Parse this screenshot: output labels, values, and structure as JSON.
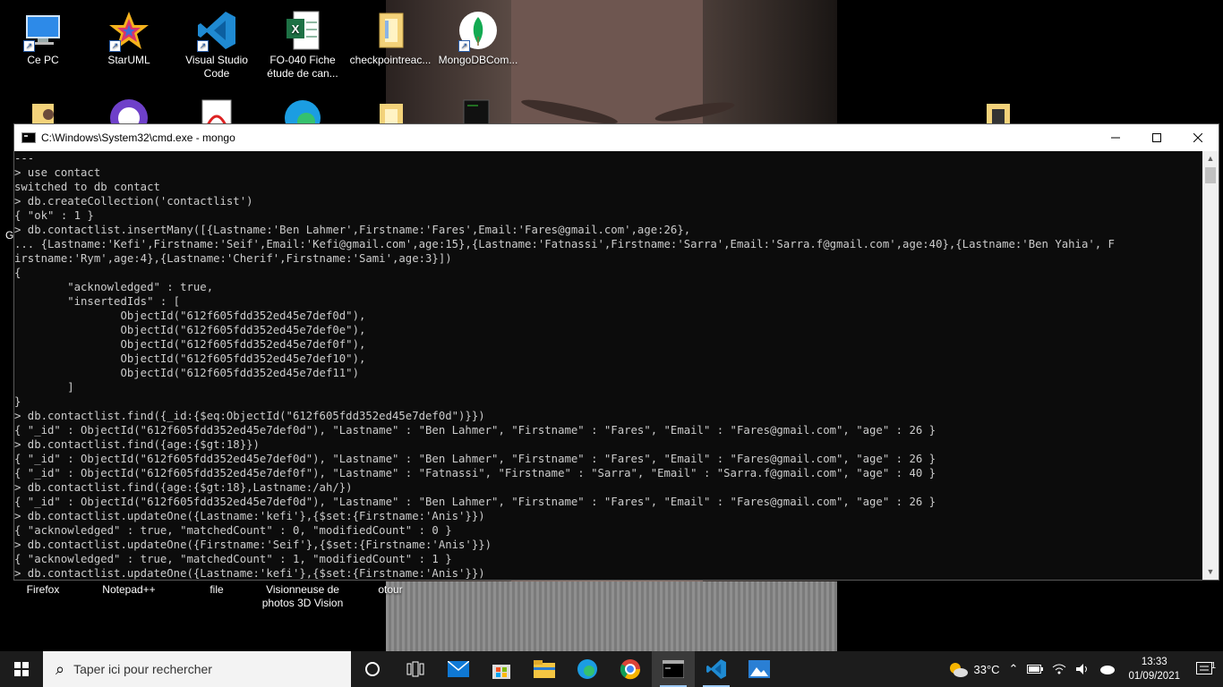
{
  "desktop": {
    "icons_row1": [
      {
        "label": "Ce PC",
        "icon": "computer-icon"
      },
      {
        "label": "StarUML",
        "icon": "staruml-icon"
      },
      {
        "label": "Visual Studio Code",
        "icon": "vscode-icon"
      },
      {
        "label": "FO-040 Fiche étude de can...",
        "icon": "excel-file-icon"
      },
      {
        "label": "checkpointreac...",
        "icon": "folder-icon"
      },
      {
        "label": "MongoDBCom...",
        "icon": "mongodb-icon"
      }
    ],
    "icons_row3": [
      {
        "label": "Firefox"
      },
      {
        "label": "Notepad++"
      },
      {
        "label": "file"
      },
      {
        "label": "Visionneuse de photos 3D Vision"
      },
      {
        "label": "otour"
      }
    ],
    "partial_letter": "G"
  },
  "cmd": {
    "title": "C:\\Windows\\System32\\cmd.exe - mongo",
    "lines": [
      "---",
      "> use contact",
      "switched to db contact",
      "> db.createCollection('contactlist')",
      "{ \"ok\" : 1 }",
      "> db.contactlist.insertMany([{Lastname:'Ben Lahmer',Firstname:'Fares',Email:'Fares@gmail.com',age:26},",
      "... {Lastname:'Kefi',Firstname:'Seif',Email:'Kefi@gmail.com',age:15},{Lastname:'Fatnassi',Firstname:'Sarra',Email:'Sarra.f@gmail.com',age:40},{Lastname:'Ben Yahia', F",
      "irstname:'Rym',age:4},{Lastname:'Cherif',Firstname:'Sami',age:3}])",
      "{",
      "        \"acknowledged\" : true,",
      "        \"insertedIds\" : [",
      "                ObjectId(\"612f605fdd352ed45e7def0d\"),",
      "                ObjectId(\"612f605fdd352ed45e7def0e\"),",
      "                ObjectId(\"612f605fdd352ed45e7def0f\"),",
      "                ObjectId(\"612f605fdd352ed45e7def10\"),",
      "                ObjectId(\"612f605fdd352ed45e7def11\")",
      "        ]",
      "}",
      "> db.contactlist.find({_id:{$eq:ObjectId(\"612f605fdd352ed45e7def0d\")}})",
      "{ \"_id\" : ObjectId(\"612f605fdd352ed45e7def0d\"), \"Lastname\" : \"Ben Lahmer\", \"Firstname\" : \"Fares\", \"Email\" : \"Fares@gmail.com\", \"age\" : 26 }",
      "> db.contactlist.find({age:{$gt:18}})",
      "{ \"_id\" : ObjectId(\"612f605fdd352ed45e7def0d\"), \"Lastname\" : \"Ben Lahmer\", \"Firstname\" : \"Fares\", \"Email\" : \"Fares@gmail.com\", \"age\" : 26 }",
      "{ \"_id\" : ObjectId(\"612f605fdd352ed45e7def0f\"), \"Lastname\" : \"Fatnassi\", \"Firstname\" : \"Sarra\", \"Email\" : \"Sarra.f@gmail.com\", \"age\" : 40 }",
      "> db.contactlist.find({age:{$gt:18},Lastname:/ah/})",
      "{ \"_id\" : ObjectId(\"612f605fdd352ed45e7def0d\"), \"Lastname\" : \"Ben Lahmer\", \"Firstname\" : \"Fares\", \"Email\" : \"Fares@gmail.com\", \"age\" : 26 }",
      "> db.contactlist.updateOne({Lastname:'kefi'},{$set:{Firstname:'Anis'}})",
      "{ \"acknowledged\" : true, \"matchedCount\" : 0, \"modifiedCount\" : 0 }",
      "> db.contactlist.updateOne({Firstname:'Seif'},{$set:{Firstname:'Anis'}})",
      "{ \"acknowledged\" : true, \"matchedCount\" : 1, \"modifiedCount\" : 1 }",
      "> db.contactlist.updateOne({Lastname:'kefi'},{$set:{Firstname:'Anis'}})"
    ]
  },
  "taskbar": {
    "search_placeholder": "Taper ici pour rechercher",
    "weather": "33°C",
    "time": "13:33",
    "date": "01/09/2021",
    "notifications": "1",
    "colors": {
      "taskbar": "#1c1c1c",
      "accent": "#9cc9f5"
    }
  }
}
